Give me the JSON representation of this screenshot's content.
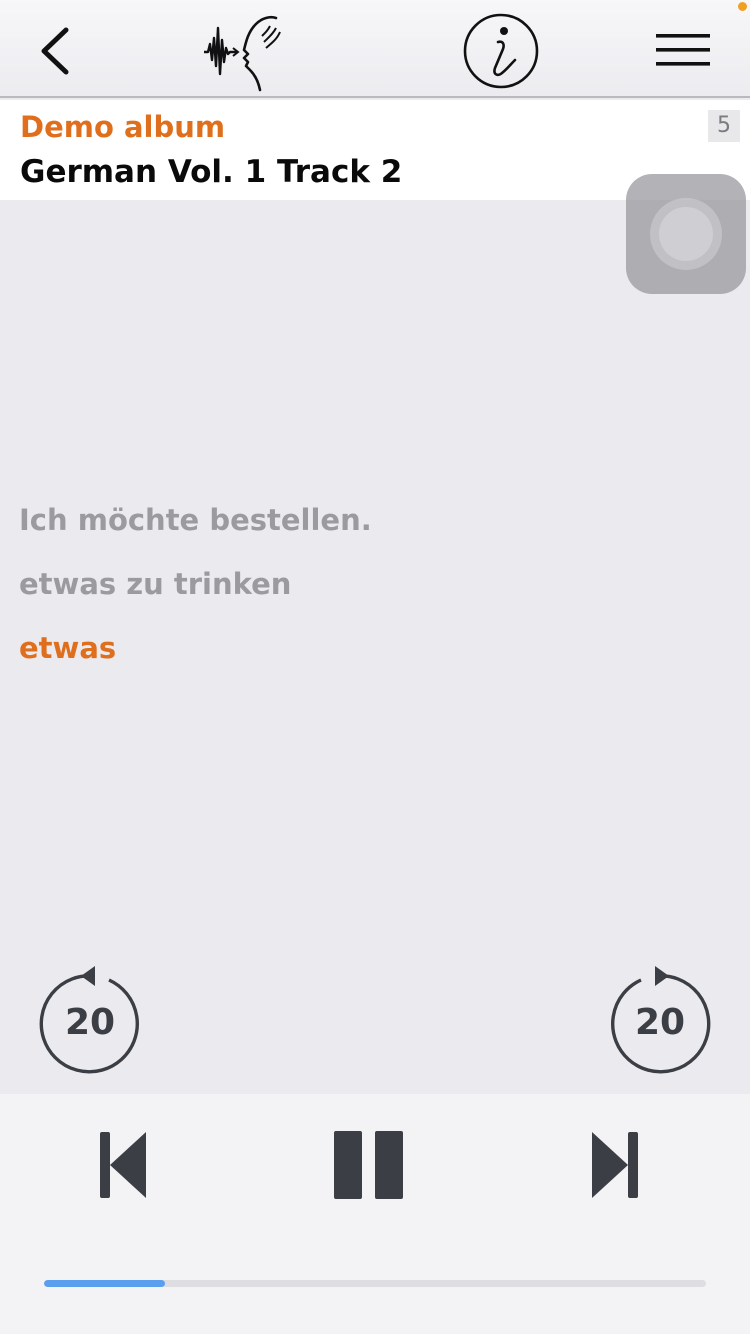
{
  "navbar": {
    "back_icon": "chevron-left-icon",
    "logo_icon": "speaking-head-soundwave-icon",
    "info_icon": "info-circle-icon",
    "menu_icon": "hamburger-menu-icon"
  },
  "track": {
    "album": "Demo album",
    "title": "German Vol. 1 Track 2",
    "count": "5"
  },
  "phrases": [
    {
      "text": "Ich möchte bestellen.",
      "state": "played"
    },
    {
      "text": "etwas zu trinken",
      "state": "played"
    },
    {
      "text": "etwas",
      "state": "current"
    }
  ],
  "controls": {
    "skip_back_label": "20",
    "skip_forward_label": "20",
    "prev_icon": "skip-previous-icon",
    "pause_icon": "pause-icon",
    "next_icon": "skip-next-icon"
  },
  "progress": {
    "fraction": 0.183
  },
  "colors": {
    "accent": "#e06f1d",
    "phrase_dim": "#9b9b9f",
    "control_dark": "#3b3e45",
    "progress_fill": "#5a9ef0"
  }
}
